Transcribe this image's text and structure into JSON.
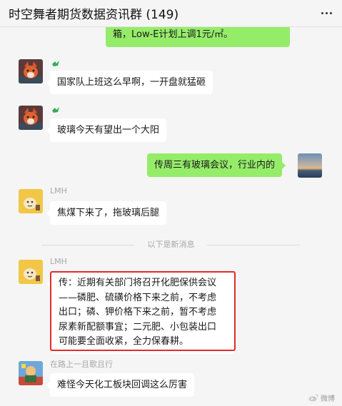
{
  "header": {
    "title": "时空舞者期货数据资讯群 (149)",
    "more_icon": "more-dots-icon"
  },
  "messages": [
    {
      "side": "right",
      "text": "箱，Low-E计划上调1元/㎡。"
    },
    {
      "side": "left",
      "sender": "",
      "avatar": "fox-avatar",
      "text": "国家队上班这么早啊，一开盘就猛砸"
    },
    {
      "side": "left",
      "sender": "",
      "avatar": "fox-avatar",
      "text": "玻璃今天有望出一个大阳"
    },
    {
      "side": "right",
      "avatar": "sunset-avatar",
      "text": "传周三有玻璃会议，行业内的"
    },
    {
      "side": "left",
      "sender": "LMH",
      "avatar": "cartoon-avatar",
      "text": "焦煤下来了，拖玻璃后腿"
    },
    {
      "side": "left",
      "sender": "LMH",
      "avatar": "cartoon-avatar",
      "lines": [
        "传：近期有关部门将召开化肥保供会议",
        "——磷肥、硫磺价格下来之前，不考虑",
        "出口；磷、钾价格下来之前，暂不考虑",
        "尿素新配额事宜；二元肥、小包装出口",
        "可能要全面收紧，全力保春耕。"
      ]
    },
    {
      "side": "left",
      "sender": "在路上一且歌且行",
      "avatar": "colorful-avatar",
      "text": "难怪今天化工板块回调这么厉害"
    }
  ],
  "divider": {
    "text": "以下是新消息"
  },
  "watermark": {
    "text": "微博"
  },
  "colors": {
    "right_bubble": "#95ec69",
    "left_bubble": "#ffffff",
    "highlight_border": "#e32b2b",
    "background": "#f5f5f5"
  }
}
